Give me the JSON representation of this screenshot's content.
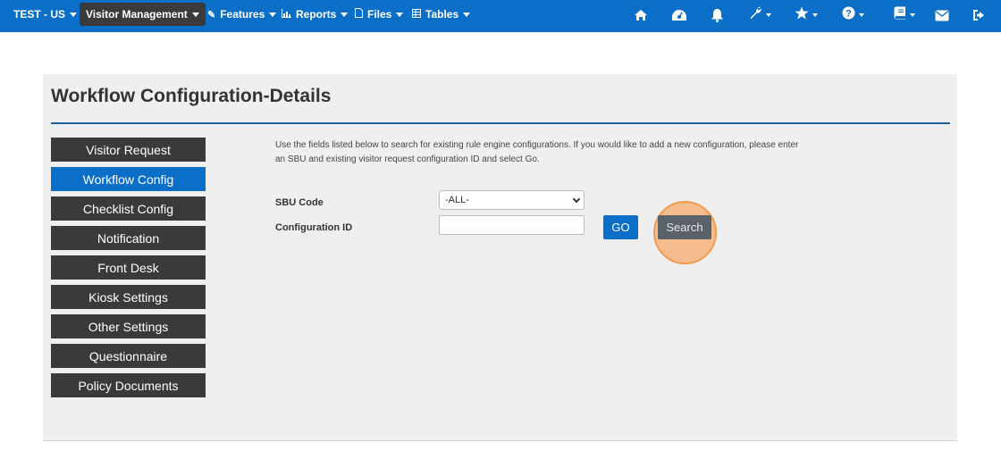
{
  "navbar": {
    "org": "TEST - US",
    "active_module": "Visitor Management",
    "menus": [
      {
        "label": "Features",
        "icon": "pencil-icon"
      },
      {
        "label": "Reports",
        "icon": "bar-chart-icon"
      },
      {
        "label": "Files",
        "icon": "file-icon"
      },
      {
        "label": "Tables",
        "icon": "table-icon"
      }
    ],
    "right_icons": [
      "home-icon",
      "dashboard-icon",
      "bell-icon",
      "wrench-icon",
      "star-icon",
      "help-icon",
      "book-icon",
      "envelope-icon",
      "logout-icon"
    ]
  },
  "page": {
    "title": "Workflow Configuration-Details"
  },
  "sidebar": {
    "items": [
      {
        "label": "Visitor Request",
        "active": false
      },
      {
        "label": "Workflow Config",
        "active": true
      },
      {
        "label": "Checklist Config",
        "active": false
      },
      {
        "label": "Notification",
        "active": false
      },
      {
        "label": "Front Desk",
        "active": false
      },
      {
        "label": "Kiosk Settings",
        "active": false
      },
      {
        "label": "Other Settings",
        "active": false
      },
      {
        "label": "Questionnaire",
        "active": false
      },
      {
        "label": "Policy Documents",
        "active": false
      }
    ]
  },
  "form": {
    "help_text": "Use the fields listed below to search for existing rule engine configurations. If you would like to add a new configuration, please enter an SBU and existing visitor request configuration ID and select Go.",
    "sbu_label": "SBU Code",
    "sbu_value": "-ALL-",
    "config_label": "Configuration ID",
    "config_value": "",
    "go_label": "GO",
    "search_label": "Search"
  },
  "colors": {
    "navbar": "#0b6fc8",
    "active_module_bg": "#3b3b3b",
    "sidebar_btn": "#3a3a3a",
    "sidebar_active": "#0b6fc8",
    "highlight": "#f7ab6e"
  }
}
